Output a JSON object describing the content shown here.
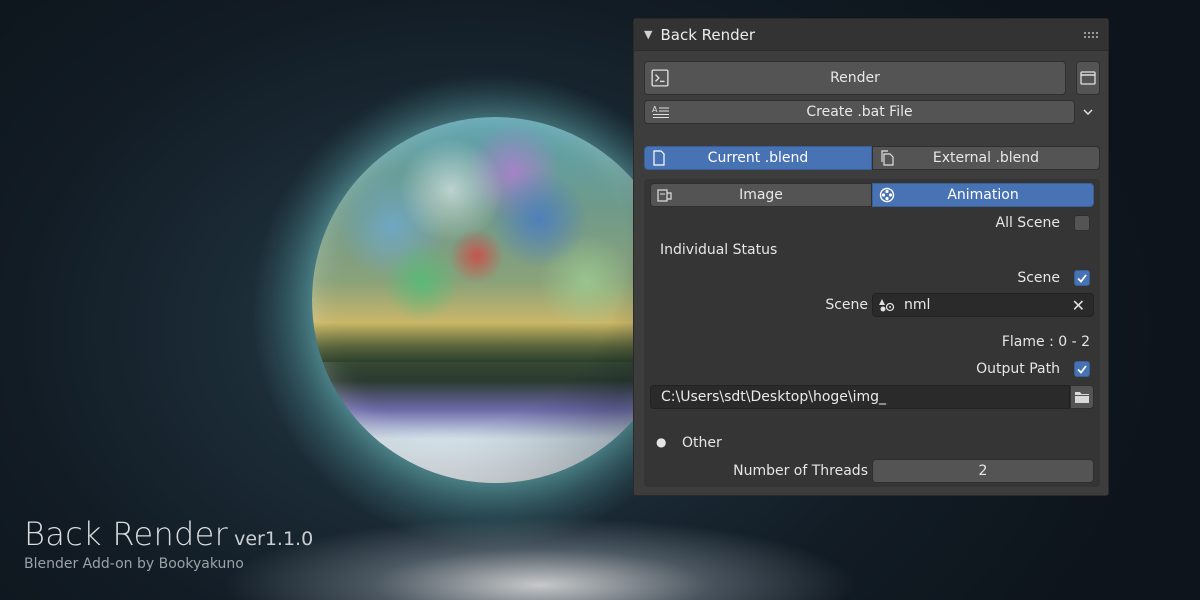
{
  "branding": {
    "title": "Back Render",
    "version": "ver1.1.0",
    "subtitle": "Blender Add-on by Bookyakuno"
  },
  "panel": {
    "title": "Back Render",
    "render_label": "Render",
    "create_bat_label": "Create .bat File",
    "source_tabs": [
      {
        "label": "Current .blend",
        "active": true,
        "icon": "file-icon"
      },
      {
        "label": "External .blend",
        "active": false,
        "icon": "file-copy-icon"
      }
    ],
    "mode_tabs": [
      {
        "label": "Image",
        "active": false,
        "icon": "image-render-icon"
      },
      {
        "label": "Animation",
        "active": true,
        "icon": "film-reel-icon"
      }
    ],
    "all_scene_label": "All Scene",
    "all_scene_checked": false,
    "individual_status_label": "Individual Status",
    "scene_checkbox_label": "Scene",
    "scene_checked": true,
    "scene_field_label": "Scene",
    "scene_value": "nml",
    "frame_text": "Flame : 0 - 2",
    "output_path_label": "Output Path",
    "output_path_checked": true,
    "output_path_value": "C:\\Users\\sdt\\Desktop\\hoge\\img_",
    "other_label": "Other",
    "threads_label": "Number of Threads",
    "threads_value": "2"
  },
  "colors": {
    "panel_bg": "#3d3d3d",
    "active_blue": "#4772b3",
    "button_gray": "#545454"
  }
}
